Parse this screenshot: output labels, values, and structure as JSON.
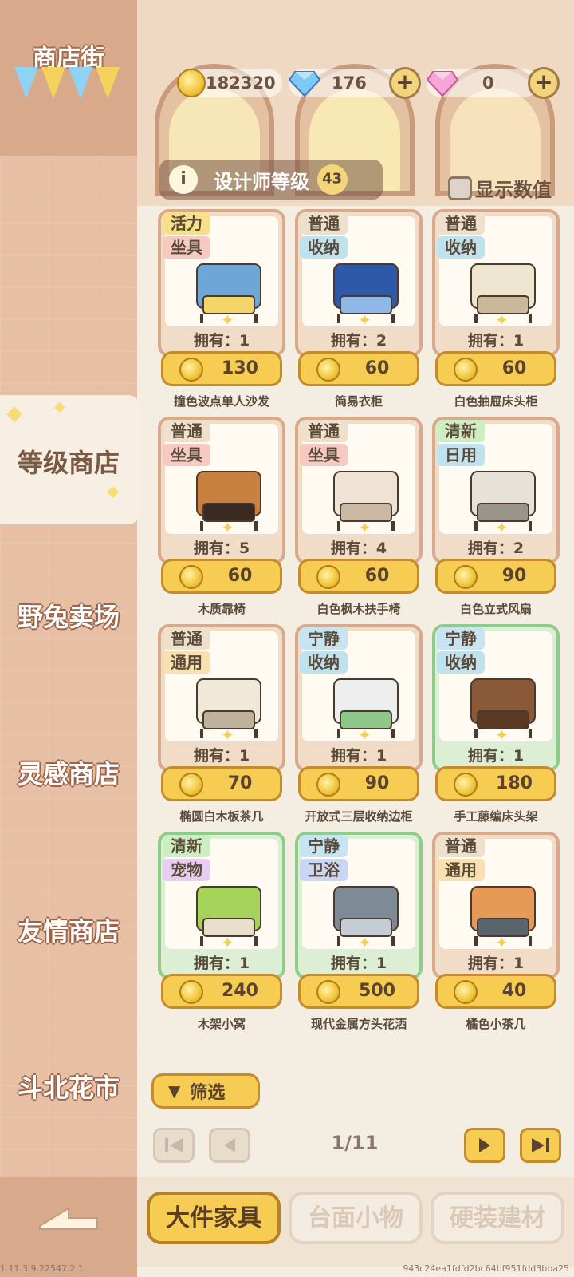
{
  "sidebar": {
    "title": "商店街",
    "bunting_colors": [
      "#8fd3f4",
      "#f5d25b",
      "#8fd3f4",
      "#f5d25b"
    ],
    "items": [
      {
        "label": "等级商店",
        "active": true
      },
      {
        "label": "野兔卖场",
        "active": false
      },
      {
        "label": "灵感商店",
        "active": false
      },
      {
        "label": "友情商店",
        "active": false
      },
      {
        "label": "斗北花市",
        "active": false
      }
    ]
  },
  "currencies": {
    "gold": "182320",
    "diamond": "176",
    "pink_gem": "0"
  },
  "designer_level": {
    "label": "设计师等级",
    "value": "43"
  },
  "show_values_label": "显示数值",
  "items": [
    {
      "tag1": "活力",
      "tag1_color": "#f8e08a",
      "tag2": "坐具",
      "tag2_color": "#f6c9c2",
      "owned": "拥有：1",
      "price": "130",
      "name": "撞色波点单人沙发",
      "frame": "normal"
    },
    {
      "tag1": "普通",
      "tag1_color": "#efe0cc",
      "tag2": "收纳",
      "tag2_color": "#bfe3ee",
      "owned": "拥有：2",
      "price": "60",
      "name": "简易衣柜",
      "frame": "normal"
    },
    {
      "tag1": "普通",
      "tag1_color": "#efe0cc",
      "tag2": "收纳",
      "tag2_color": "#bfe3ee",
      "owned": "拥有：1",
      "price": "60",
      "name": "白色抽屉床头柜",
      "frame": "normal"
    },
    {
      "tag1": "普通",
      "tag1_color": "#efe0cc",
      "tag2": "坐具",
      "tag2_color": "#f6c9c2",
      "owned": "拥有：5",
      "price": "60",
      "name": "木质靠椅",
      "frame": "normal"
    },
    {
      "tag1": "普通",
      "tag1_color": "#efe0cc",
      "tag2": "坐具",
      "tag2_color": "#f6c9c2",
      "owned": "拥有：4",
      "price": "60",
      "name": "白色枫木扶手椅",
      "frame": "normal"
    },
    {
      "tag1": "清新",
      "tag1_color": "#cdeec0",
      "tag2": "日用",
      "tag2_color": "#bfe3ee",
      "owned": "拥有：2",
      "price": "90",
      "name": "白色立式风扇",
      "frame": "normal"
    },
    {
      "tag1": "普通",
      "tag1_color": "#efe0cc",
      "tag2": "通用",
      "tag2_color": "#f8e0b0",
      "owned": "拥有：1",
      "price": "70",
      "name": "椭圆白木板茶几",
      "frame": "normal"
    },
    {
      "tag1": "宁静",
      "tag1_color": "#c6e4f2",
      "tag2": "收纳",
      "tag2_color": "#bfe3ee",
      "owned": "拥有：1",
      "price": "90",
      "name": "开放式三层收纳边柜",
      "frame": "normal"
    },
    {
      "tag1": "宁静",
      "tag1_color": "#c6e4f2",
      "tag2": "收纳",
      "tag2_color": "#bfe3ee",
      "owned": "拥有：1",
      "price": "180",
      "name": "手工藤编床头架",
      "frame": "green"
    },
    {
      "tag1": "清新",
      "tag1_color": "#cdeec0",
      "tag2": "宠物",
      "tag2_color": "#e8cdf2",
      "owned": "拥有：1",
      "price": "240",
      "name": "木架小窝",
      "frame": "green"
    },
    {
      "tag1": "宁静",
      "tag1_color": "#c6e4f2",
      "tag2": "卫浴",
      "tag2_color": "#c9d6f4",
      "owned": "拥有：1",
      "price": "500",
      "name": "现代金属方头花洒",
      "frame": "green"
    },
    {
      "tag1": "普通",
      "tag1_color": "#efe0cc",
      "tag2": "通用",
      "tag2_color": "#f8e0b0",
      "owned": "拥有：1",
      "price": "40",
      "name": "橘色小茶几",
      "frame": "normal"
    }
  ],
  "filter_label": "筛选",
  "pagination": {
    "current": "1/11"
  },
  "tabs": [
    {
      "label": "大件家具",
      "active": true
    },
    {
      "label": "台面小物",
      "active": false
    },
    {
      "label": "硬装建材",
      "active": false
    }
  ],
  "footer": {
    "version": "1.11.3.9.22547.2.1",
    "hash": "943c24ea1fdfd2bc64bf951fdd3bba25"
  }
}
